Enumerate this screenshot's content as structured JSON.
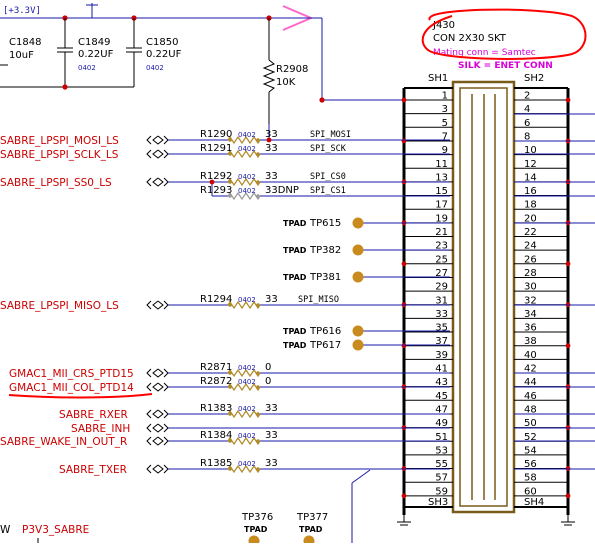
{
  "power": {
    "rail_label": "[+3.3V]",
    "p3v3_label": "P3V3_SABRE",
    "p3v3_prefix": "W"
  },
  "capacitors": [
    {
      "ref": "C1848",
      "value": "10uF",
      "pkg": ""
    },
    {
      "ref": "C1849",
      "value": "0.22UF",
      "pkg": "0402"
    },
    {
      "ref": "C1850",
      "value": "0.22UF",
      "pkg": "0402"
    }
  ],
  "pullup": {
    "ref": "R2908",
    "value": "10K"
  },
  "connector": {
    "ref": "J430",
    "type": "CON 2X30 SKT",
    "mating": "Mating conn = Samtec",
    "silk": "SILK = ENET CONN",
    "sh1": "SH1",
    "sh2": "SH2",
    "sh3": "SH3",
    "sh4": "SH4",
    "pins_left": [
      "1",
      "3",
      "5",
      "7",
      "9",
      "11",
      "13",
      "15",
      "17",
      "19",
      "21",
      "23",
      "25",
      "27",
      "29",
      "31",
      "33",
      "35",
      "37",
      "39",
      "41",
      "43",
      "45",
      "47",
      "49",
      "51",
      "53",
      "55",
      "57",
      "59"
    ],
    "pins_right": [
      "2",
      "4",
      "6",
      "8",
      "10",
      "12",
      "14",
      "16",
      "18",
      "20",
      "22",
      "24",
      "26",
      "28",
      "30",
      "32",
      "34",
      "36",
      "38",
      "40",
      "42",
      "44",
      "46",
      "48",
      "50",
      "52",
      "54",
      "56",
      "58",
      "60"
    ]
  },
  "signals": [
    {
      "name": "SABRE_LPSPI_MOSI_LS",
      "res": "R1290",
      "pkg": "0402",
      "val": "33",
      "net": "SPI_MOSI"
    },
    {
      "name": "SABRE_LPSPI_SCLK_LS",
      "res": "R1291",
      "pkg": "0402",
      "val": "33",
      "net": "SPI_SCK"
    },
    {
      "name": "SABRE_LPSPI_SS0_LS",
      "res": "R1292",
      "pkg": "0402",
      "val": "33",
      "net": "SPI_CS0"
    },
    {
      "name": "",
      "res": "R1293",
      "pkg": "0402",
      "val": "33DNP",
      "net": "SPI_CS1"
    },
    {
      "name": "SABRE_LPSPI_MISO_LS",
      "res": "R1294",
      "pkg": "0402",
      "val": "33",
      "net": "SPI_MISO"
    },
    {
      "name": "GMAC1_MII_CRS_PTD15",
      "res": "R2871",
      "pkg": "0402",
      "val": "0",
      "net": ""
    },
    {
      "name": "GMAC1_MII_COL_PTD14",
      "res": "R2872",
      "pkg": "0402",
      "val": "0",
      "net": ""
    },
    {
      "name": "SABRE_RXER",
      "res": "R1383",
      "pkg": "0402",
      "val": "33",
      "net": ""
    },
    {
      "name": "SABRE_INH",
      "res": "",
      "pkg": "",
      "val": "",
      "net": ""
    },
    {
      "name": "SABRE_WAKE_IN_OUT_R",
      "res": "R1384",
      "pkg": "0402",
      "val": "33",
      "net": ""
    },
    {
      "name": "SABRE_TXER",
      "res": "R1385",
      "pkg": "0402",
      "val": "33",
      "net": ""
    }
  ],
  "testpoints": [
    {
      "kind": "TPAD",
      "ref": "TP615"
    },
    {
      "kind": "TPAD",
      "ref": "TP382"
    },
    {
      "kind": "TPAD",
      "ref": "TP381"
    },
    {
      "kind": "TPAD",
      "ref": "TP616"
    },
    {
      "kind": "TPAD",
      "ref": "TP617"
    },
    {
      "kind": "TPAD",
      "ref": "TP376"
    },
    {
      "kind": "TPAD",
      "ref": "TP377"
    }
  ]
}
